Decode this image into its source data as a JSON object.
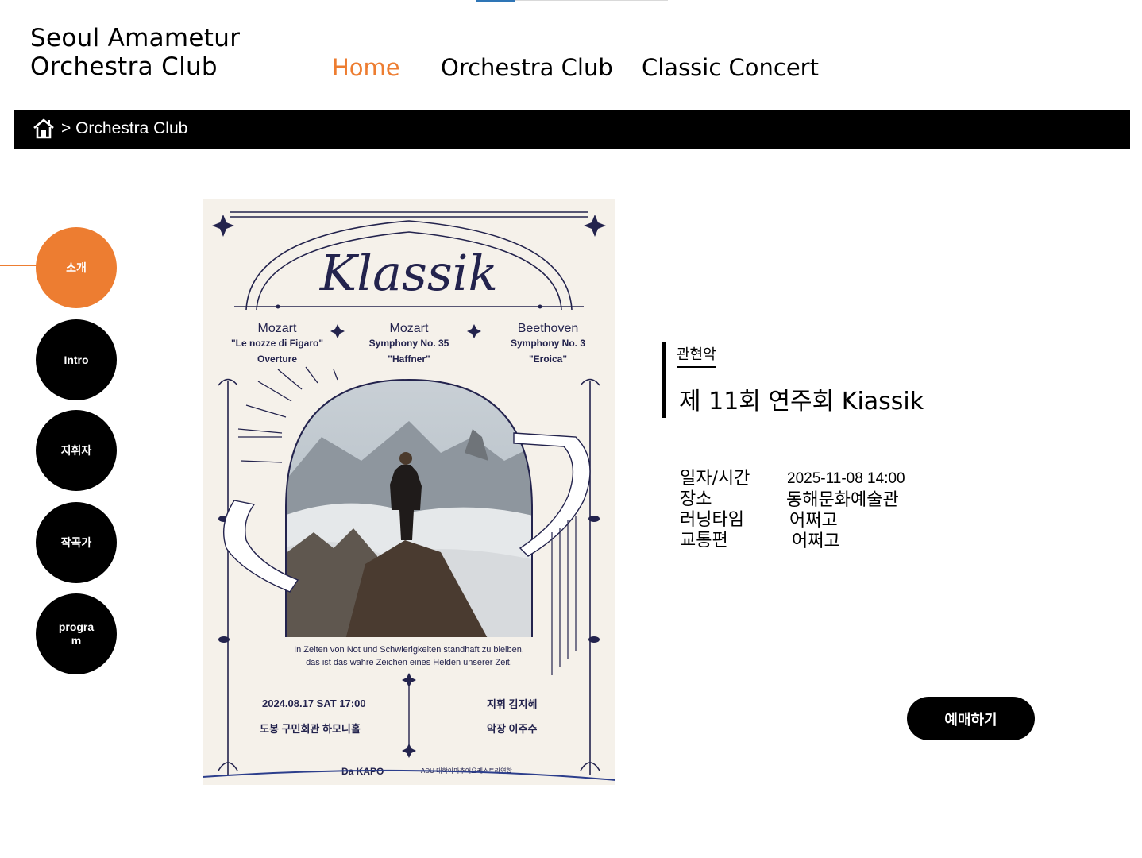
{
  "logo": {
    "line1": "Seoul Amametur",
    "line2": "Orchestra Club"
  },
  "nav": {
    "home": "Home",
    "orchestra": "Orchestra Club",
    "concert": "Classic Concert"
  },
  "breadcrumb": {
    "text": "> Orchestra Club"
  },
  "sidebar": {
    "items": [
      {
        "label": "소개",
        "active": true
      },
      {
        "label": "Intro"
      },
      {
        "label": "지휘자"
      },
      {
        "label": "작곡가"
      },
      {
        "label": "program"
      }
    ]
  },
  "poster": {
    "title": "Klassik",
    "pieces": [
      {
        "composer": "Mozart",
        "work": "\"Le nozze di Figaro\"",
        "sub": "Overture"
      },
      {
        "composer": "Mozart",
        "work": "Symphony No. 35",
        "sub": "\"Haffner\""
      },
      {
        "composer": "Beethoven",
        "work": "Symphony No. 3",
        "sub": "\"Eroica\""
      }
    ],
    "quote1": "In Zeiten von Not und Schwierigkeiten standhaft zu bleiben,",
    "quote2": "das ist das wahre Zeichen eines Helden unserer Zeit.",
    "date": "2024.08.17 SAT 17:00",
    "venue": "도봉 구민회관 하모니홀",
    "conductor": "지휘 김지혜",
    "concertmaster": "악장 이주수",
    "sponsor1": "Da KAPO",
    "sponsor2": "ADU 대학아마추어오케스트라연합"
  },
  "concert": {
    "category": "관현악",
    "title": "제 11회 연주회 Kiassik",
    "details": [
      {
        "label": "일자/시간",
        "value": "2025-11-08 14:00"
      },
      {
        "label": "장소",
        "value": "동해문화예술관"
      },
      {
        "label": "러닝타임",
        "value": "어쩌고"
      },
      {
        "label": "교통편",
        "value": "어쩌고"
      }
    ]
  },
  "reserve_button": "예매하기",
  "colors": {
    "accent": "#ed7d31",
    "dark": "#000000",
    "poster_bg": "#f5f1ea",
    "poster_ink": "#23234d"
  }
}
